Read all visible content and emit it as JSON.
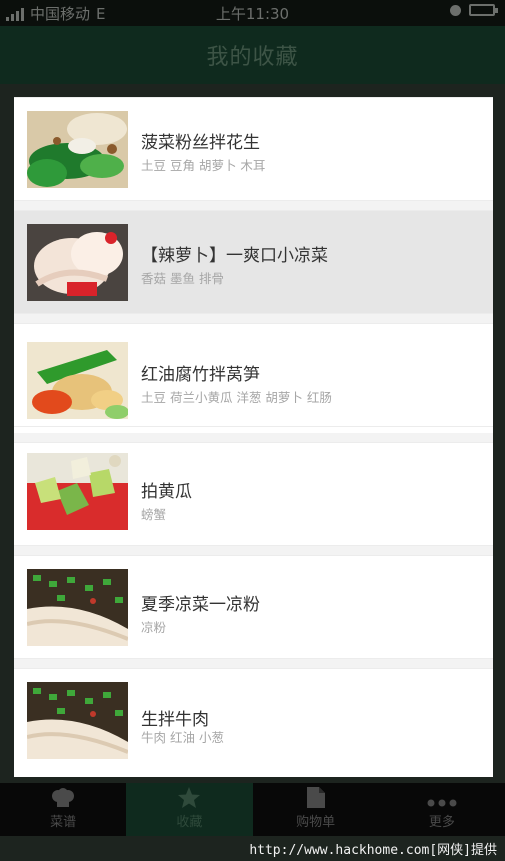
{
  "status_bar": {
    "carrier": "中国移动",
    "network": "E",
    "time": "上午11:30"
  },
  "header": {
    "title": "我的收藏"
  },
  "favorites": [
    {
      "title": "菠菜粉丝拌花生",
      "tags": "土豆  豆角  胡萝卜  木耳"
    },
    {
      "title": "【辣萝卜】一爽口小凉菜",
      "tags": "香菇  墨鱼  排骨"
    },
    {
      "title": "红油腐竹拌莴笋",
      "tags": "土豆  荷兰小黄瓜  洋葱  胡萝卜  红肠"
    },
    {
      "title": "拍黄瓜",
      "tags": "螃蟹"
    },
    {
      "title": "夏季凉菜一凉粉",
      "tags": "凉粉"
    },
    {
      "title": "生拌牛肉",
      "tags": "牛肉  红油  小葱"
    }
  ],
  "tabs": [
    {
      "label": "菜谱",
      "icon": "chef-hat-icon"
    },
    {
      "label": "收藏",
      "icon": "star-icon"
    },
    {
      "label": "购物单",
      "icon": "document-icon"
    },
    {
      "label": "更多",
      "icon": "more-dots-icon"
    }
  ],
  "active_tab_index": 1,
  "selected_item_index": 1,
  "watermark": "http://www.hackhome.com[网侠]提供",
  "colors": {
    "header_bg": "#0f2a1e",
    "tab_active_bg": "#0f2a1e",
    "selected_row_bg": "#e6e6e6"
  }
}
